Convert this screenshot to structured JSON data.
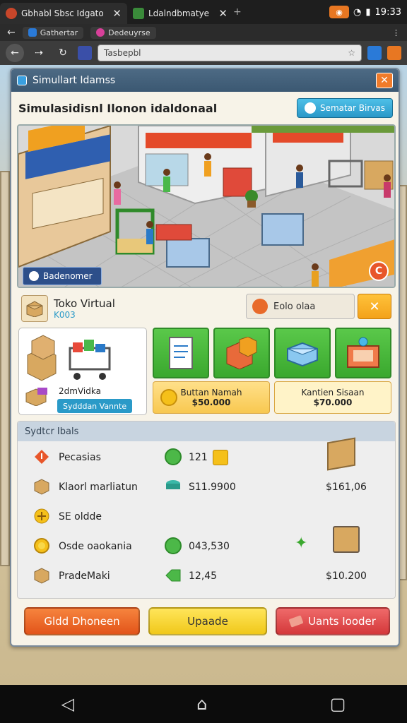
{
  "status_bar": {
    "tab1_title": "Gbhabl Sbsc Idgato",
    "tab2_title": "Ldalndbmatye",
    "time": "19:33"
  },
  "browser": {
    "tab_a": "Gathertar",
    "tab_b": "Dedeuyrse",
    "url": "Tasbepbl"
  },
  "window": {
    "title": "Simullart Idamss",
    "page_title": "Simulasidisnl Ilonon idaldonaal",
    "header_button": "Sematar Birvas"
  },
  "scene": {
    "tag": "Badenomer",
    "corner_badge": "C"
  },
  "store": {
    "name": "Toko Virtual",
    "code": "K003"
  },
  "search": {
    "text": "Eolo olaa"
  },
  "product_card": {
    "label": "2dmVidka",
    "badge": "Sydddan Vannte"
  },
  "price_cards": [
    {
      "name": "Buttan Namah",
      "price": "$50.000"
    },
    {
      "name": "Kantien Sisaan",
      "price": "$70.000"
    }
  ],
  "stats": {
    "header": "Sydtcr Ibals",
    "rows": [
      {
        "label": "Pecasias",
        "value": "121",
        "value2": ""
      },
      {
        "label": "Klaorl marliatun",
        "value": "S11.9900",
        "value2": "$161,06"
      },
      {
        "label": "SE oldde",
        "value": "",
        "value2": ""
      },
      {
        "label": "Osde oaokania",
        "value": "043,530",
        "value2": ""
      },
      {
        "label": "PradeMaki",
        "value": "12,45",
        "value2": "$10.200"
      }
    ]
  },
  "buttons": {
    "left": "Gldd Dhoneen",
    "middle": "Upaade",
    "right": "Uants Iooder"
  },
  "colors": {
    "accent_blue": "#2a9ac8",
    "tile_green": "#3aa82e",
    "orange": "#e2541a",
    "yellow": "#f0c81a",
    "red": "#d4383a"
  }
}
